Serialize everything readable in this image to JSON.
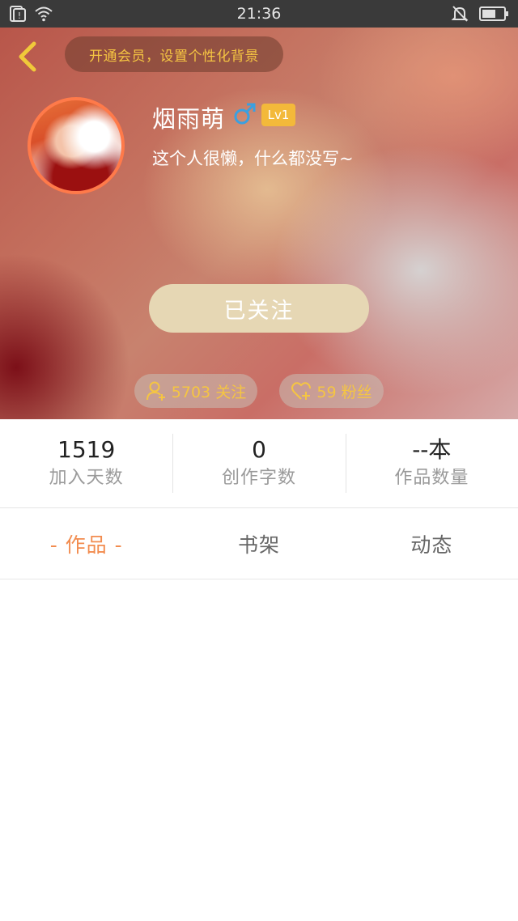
{
  "status_bar": {
    "time": "21:36",
    "left_icons": [
      "notification-icon",
      "wifi-icon"
    ],
    "right_icons": [
      "silent-bell-icon",
      "battery-icon"
    ]
  },
  "header": {
    "back_icon": "chevron-left-icon",
    "vip_banner": "开通会员，设置个性化背景",
    "username": "烟雨萌",
    "gender_icon": "male-icon",
    "level": "Lv1",
    "bio": "这个人很懒，什么都没写~",
    "follow_button": "已关注",
    "following": "5703 关注",
    "fans": "59 粉丝",
    "colors": {
      "accent_gold": "#f5c542",
      "level_badge": "#f3b93a",
      "avatar_border": "#ff7a4a",
      "gender": "#3aa0e0"
    }
  },
  "stats": [
    {
      "value": "1519",
      "label": "加入天数"
    },
    {
      "value": "0",
      "label": "创作字数"
    },
    {
      "value": "--本",
      "label": "作品数量"
    }
  ],
  "tabs": [
    {
      "label": "- 作品 -",
      "active": true
    },
    {
      "label": "书架",
      "active": false
    },
    {
      "label": "动态",
      "active": false
    }
  ],
  "colors": {
    "active_tab": "#f28c4f",
    "inactive_tab": "#666666"
  }
}
